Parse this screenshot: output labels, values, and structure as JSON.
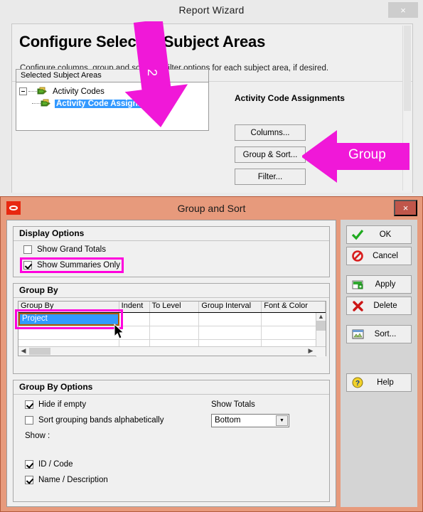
{
  "wizard": {
    "title": "Report Wizard",
    "close_label": "×",
    "heading": "Configure Selected Subject Areas",
    "subheading": "Configure columns, group and sort, and filter options for each subject area, if desired.",
    "tree": {
      "header": "Selected Subject Areas",
      "items": [
        {
          "label": "Activity Codes",
          "selected": false
        },
        {
          "label": "Activity Code Assignments",
          "selected": true
        }
      ]
    },
    "subject_title": "Activity Code Assignments",
    "buttons": [
      {
        "name": "columns",
        "label": "Columns...",
        "accel": "C"
      },
      {
        "name": "group-sort",
        "label": "Group & Sort...",
        "accel": "G"
      },
      {
        "name": "filter",
        "label": "Filter...",
        "accel": "F"
      }
    ]
  },
  "group_sort": {
    "title": "Group and Sort",
    "close_label": "×",
    "display_options": {
      "legend": "Display Options",
      "checkboxes": [
        {
          "label": "Show Grand Totals",
          "checked": false,
          "highlighted": false
        },
        {
          "label": "Show Summaries Only",
          "checked": true,
          "highlighted": true
        }
      ]
    },
    "group_by": {
      "legend": "Group By",
      "columns": [
        "Group By",
        "Indent",
        "To Level",
        "Group Interval",
        "Font & Color"
      ],
      "rows": [
        {
          "group_by": "Project",
          "indent": "",
          "to_level": "",
          "group_interval": "",
          "font_color": "",
          "selected": true
        },
        {
          "group_by": "",
          "indent": "",
          "to_level": "",
          "group_interval": "",
          "font_color": "",
          "selected": false
        },
        {
          "group_by": "",
          "indent": "",
          "to_level": "",
          "group_interval": "",
          "font_color": "",
          "selected": false
        }
      ]
    },
    "group_by_options": {
      "legend": "Group By Options",
      "checkboxes": [
        {
          "label": "Hide if empty",
          "checked": true
        },
        {
          "label": "Sort grouping bands alphabetically",
          "checked": false
        }
      ],
      "show_label": "Show :",
      "show_checkboxes": [
        {
          "label": "ID / Code",
          "checked": true
        },
        {
          "label": "Name / Description",
          "checked": true
        }
      ],
      "show_totals_label": "Show Totals",
      "show_totals_value": "Bottom"
    },
    "buttons": [
      {
        "name": "ok",
        "label": "OK",
        "icon": "green-check-icon"
      },
      {
        "name": "cancel",
        "label": "Cancel",
        "icon": "red-prohibition-icon"
      },
      {
        "name": "apply",
        "label": "Apply",
        "icon": "green-apply-icon"
      },
      {
        "name": "delete",
        "label": "Delete",
        "icon": "red-x-icon"
      },
      {
        "name": "sort",
        "label": "Sort...",
        "icon": "sort-window-icon"
      },
      {
        "name": "help",
        "label": "Help",
        "icon": "yellow-question-icon"
      }
    ]
  },
  "annotations": {
    "down_arrow_label": "2",
    "group_arrow_label": "Group",
    "color": "#ff00dd"
  }
}
